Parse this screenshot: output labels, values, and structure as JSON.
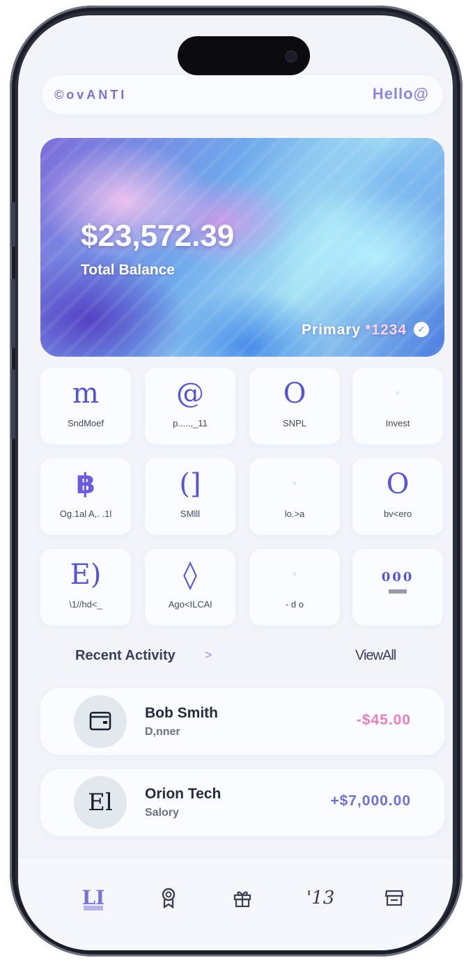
{
  "header": {
    "brand": "©ovANTI",
    "greeting": "Hello@"
  },
  "card": {
    "balance": "$23,572.39",
    "balance_label": "Total Balance",
    "account_label": "Primary",
    "account_number": "*1234"
  },
  "actions": [
    {
      "glyph": "m",
      "label": "SndMoef"
    },
    {
      "glyph": "@",
      "label": "p.....,_11"
    },
    {
      "glyph": "O",
      "label": "SNPL"
    },
    {
      "glyph": "·",
      "label": "Invest"
    },
    {
      "glyph": "฿",
      "label": "Og.1al A,. .1l"
    },
    {
      "glyph": "(]",
      "label": "SMlll"
    },
    {
      "glyph": "·",
      "label": "lo.>a"
    },
    {
      "glyph": "O",
      "label": "bv<ero"
    },
    {
      "glyph": "E)",
      "label": "\\1//hd<_"
    },
    {
      "glyph": "◊",
      "label": "Ago<ILCAl"
    },
    {
      "glyph": "·",
      "label": "- d o"
    },
    {
      "glyph": "000",
      "label": ""
    }
  ],
  "recent": {
    "title": "Recent Activity",
    "arrow": ">",
    "view_all": "ViewAll",
    "items": [
      {
        "avatar_glyph": "",
        "name": "Bob Smith",
        "sub": "D,nner",
        "amount": "-$45.00",
        "direction": "debit"
      },
      {
        "avatar_glyph": "El",
        "name": "Orion Tech",
        "sub": "Salory",
        "amount": "+$7,000.00",
        "direction": "credit"
      }
    ]
  },
  "nav": [
    {
      "icon": "home-icon",
      "glyph": "LI"
    },
    {
      "icon": "award-icon",
      "glyph": ""
    },
    {
      "icon": "gift-icon",
      "glyph": ""
    },
    {
      "icon": "calendar-icon",
      "glyph": "'13"
    },
    {
      "icon": "store-icon",
      "glyph": ""
    }
  ],
  "colors": {
    "accent": "#6e6fd8",
    "debit": "#e87fbf",
    "background": "#f2f4fa"
  }
}
